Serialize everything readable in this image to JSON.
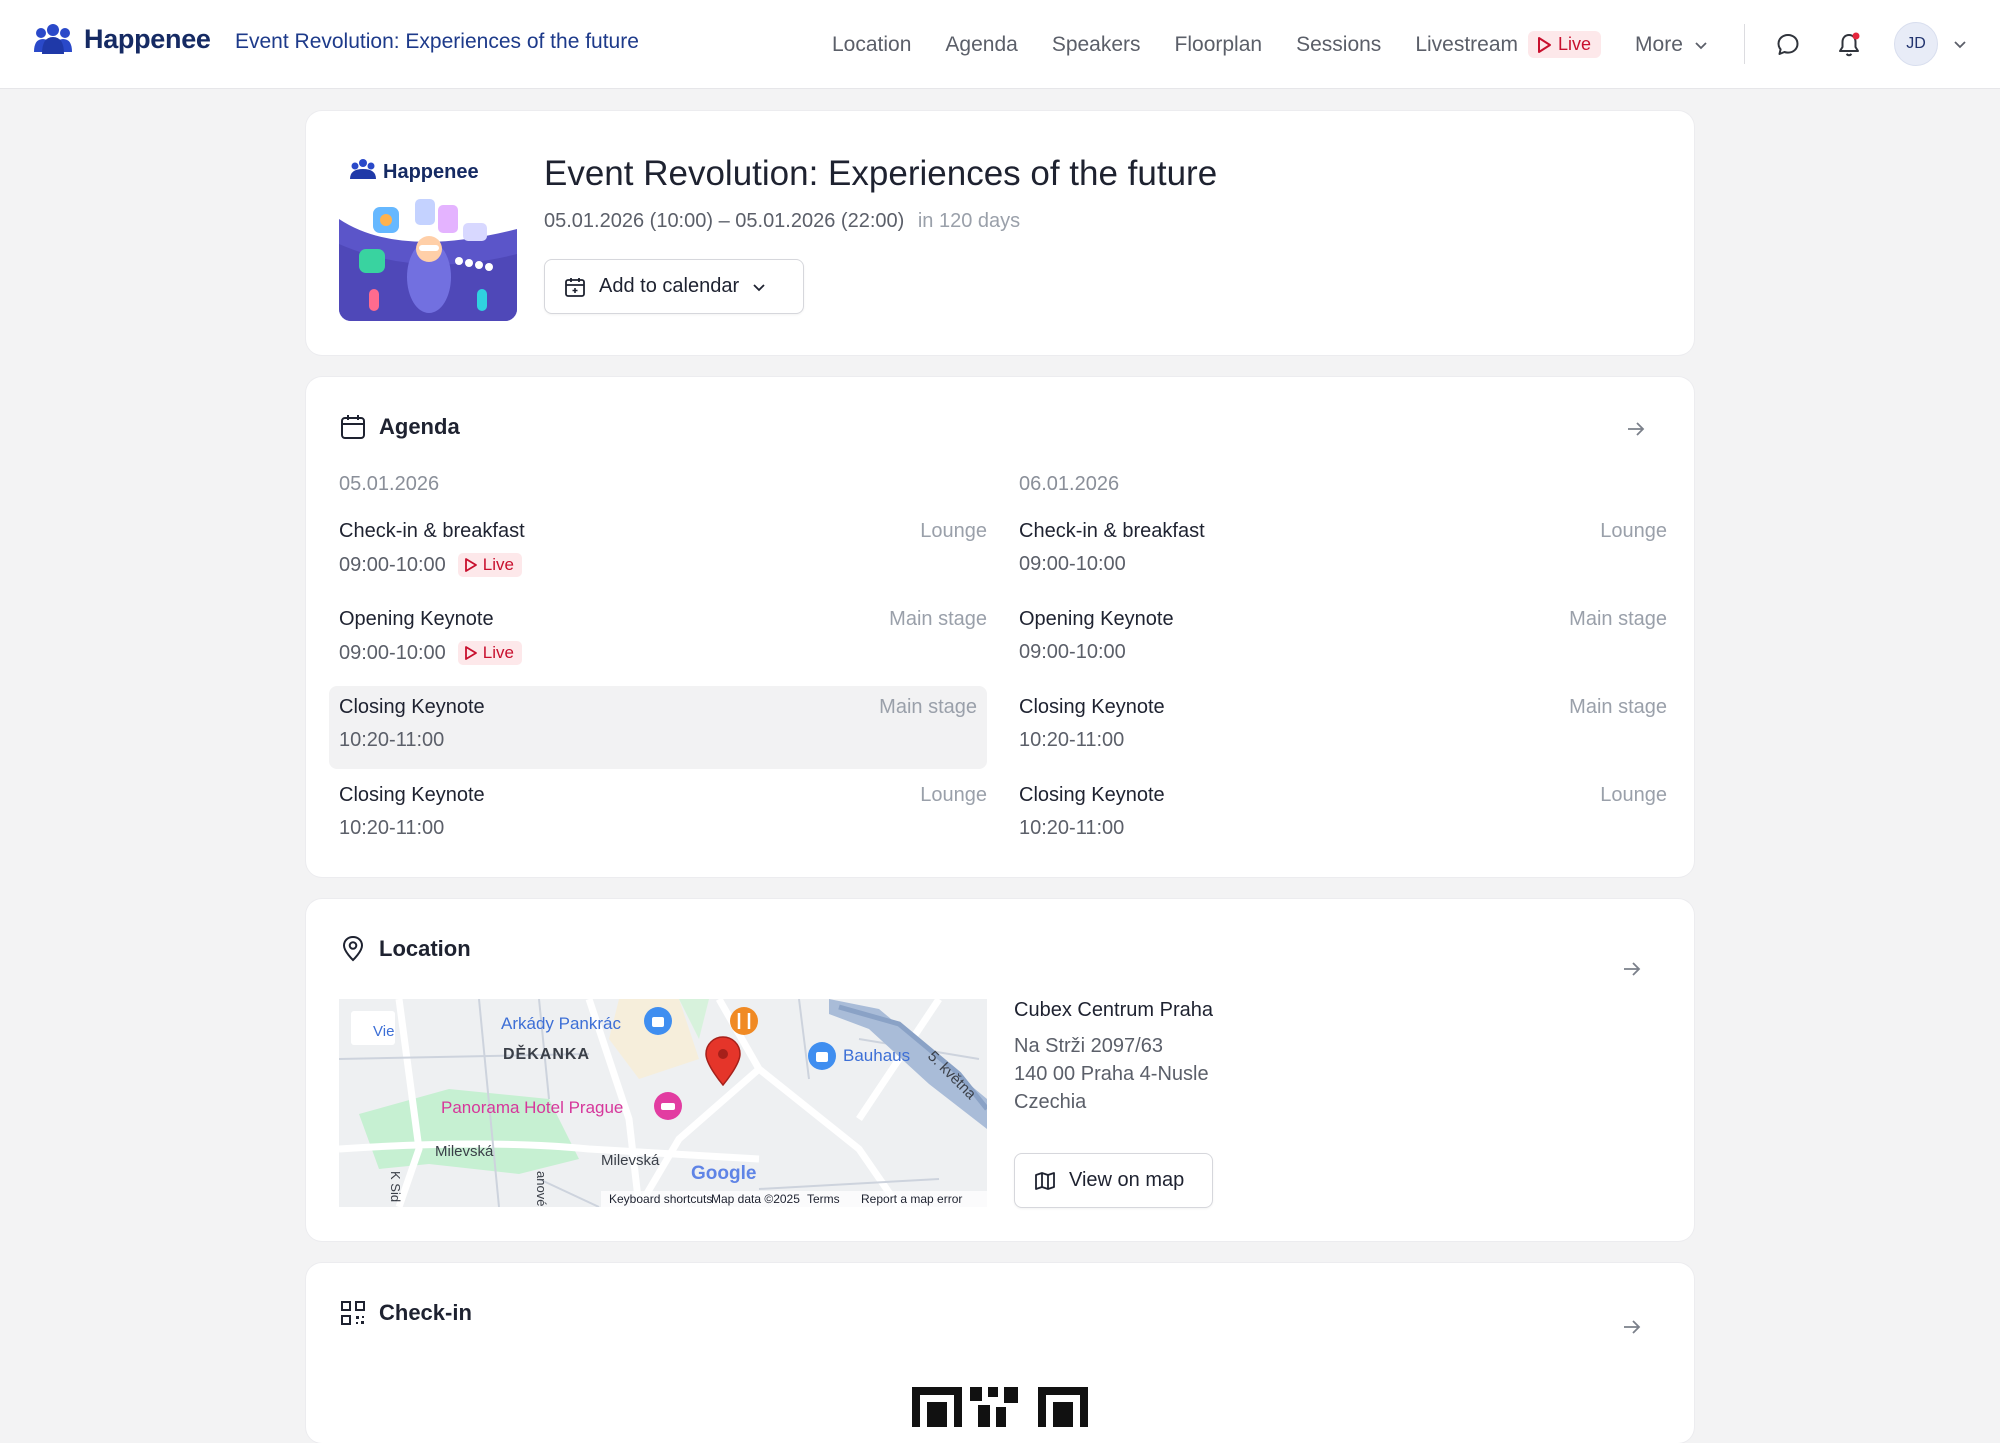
{
  "header": {
    "brand": "Happenee",
    "event_title": "Event Revolution: Experiences of the future",
    "nav": [
      "Location",
      "Agenda",
      "Speakers",
      "Floorplan",
      "Sessions"
    ],
    "livestream": "Livestream",
    "live_badge": "Live",
    "more": "More",
    "avatar_initials": "JD",
    "colors": {
      "brand": "#152a63",
      "live": "#c8102e",
      "live_bg": "#fde8ea"
    }
  },
  "hero": {
    "image_brand": "Happenee",
    "title": "Event Revolution: Experiences of the future",
    "date_range": "05.01.2026 (10:00) – 05.01.2026 (22:00)",
    "countdown": "in 120 days",
    "calendar_button": "Add to calendar"
  },
  "agenda": {
    "heading": "Agenda",
    "days": [
      {
        "date": "05.01.2026",
        "items": [
          {
            "title": "Check-in & breakfast",
            "time": "09:00-10:00",
            "place": "Lounge",
            "live": "Live"
          },
          {
            "title": "Opening Keynote",
            "time": "09:00-10:00",
            "place": "Main stage",
            "live": "Live"
          },
          {
            "title": "Closing Keynote",
            "time": "10:20-11:00",
            "place": "Main stage"
          },
          {
            "title": "Closing Keynote",
            "time": "10:20-11:00",
            "place": "Lounge"
          }
        ]
      },
      {
        "date": "06.01.2026",
        "items": [
          {
            "title": "Check-in & breakfast",
            "time": "09:00-10:00",
            "place": "Lounge"
          },
          {
            "title": "Opening Keynote",
            "time": "09:00-10:00",
            "place": "Main stage"
          },
          {
            "title": "Closing Keynote",
            "time": "10:20-11:00",
            "place": "Main stage"
          },
          {
            "title": "Closing Keynote",
            "time": "10:20-11:00",
            "place": "Lounge"
          }
        ]
      }
    ]
  },
  "location": {
    "heading": "Location",
    "venue": "Cubex Centrum Praha",
    "street": "Na Strži 2097/63",
    "city": "140 00 Praha 4-Nusle",
    "country": "Czechia",
    "map_button": "View on map",
    "map": {
      "labels": {
        "arkady": "Arkády Pankrác",
        "dekanka": "DĚKANKA",
        "bauhaus": "Bauhaus",
        "kvetna": "5. května",
        "panorama": "Panorama Hotel Prague",
        "milevska1": "Milevská",
        "milevska2": "Milevská",
        "ksid": "K Sid",
        "anove": "anové",
        "view": "Vie",
        "google": "Google",
        "shortcuts": "Keyboard shortcuts",
        "mapdata": "Map data ©2025",
        "terms": "Terms",
        "report": "Report a map error"
      }
    }
  },
  "checkin": {
    "heading": "Check-in"
  }
}
